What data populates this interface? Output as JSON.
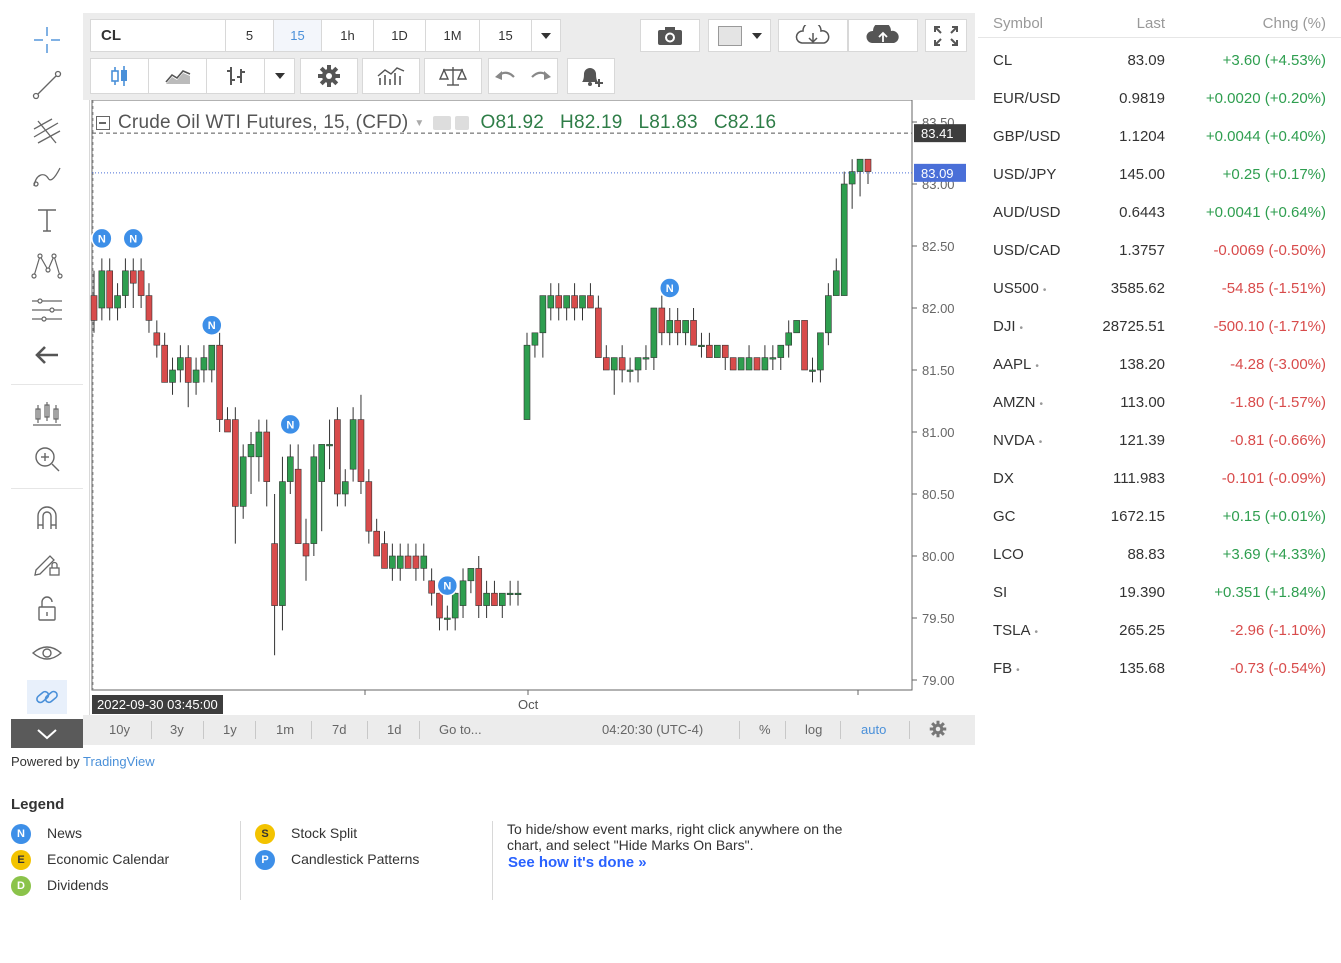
{
  "toolbar": {
    "symbol": "CL",
    "intervals": [
      "5",
      "15",
      "1h",
      "1D",
      "1M",
      "15"
    ],
    "active_interval_index": 1
  },
  "chart": {
    "title": "Crude Oil WTI Futures, 15, (CFD)",
    "ohlc": {
      "o": "O81.92",
      "h": "H82.19",
      "l": "L81.83",
      "c": "C82.16"
    },
    "price_axis": [
      "83.50",
      "83.00",
      "82.50",
      "82.00",
      "81.50",
      "81.00",
      "80.50",
      "80.00",
      "79.50",
      "79.00"
    ],
    "last_price_label": "83.09",
    "high_label": "83.41",
    "x_label_oct": "Oct",
    "crosshair_time": "2022-09-30 03:45:00",
    "news_marker": "N",
    "bottom": {
      "ranges": [
        "10y",
        "3y",
        "1y",
        "1m",
        "7d",
        "1d"
      ],
      "goto": "Go to...",
      "clock": "04:20:30 (UTC-4)",
      "percent": "%",
      "log": "log",
      "auto": "auto"
    },
    "colors": {
      "up": "#2e9e4f",
      "down": "#d84b4b",
      "last": "#4a6fd8"
    }
  },
  "watchlist": {
    "headers": {
      "symbol": "Symbol",
      "last": "Last",
      "change": "Chng (%)"
    },
    "rows": [
      {
        "symbol": "CL",
        "last": "83.09",
        "change": "+3.60 (+4.53%)",
        "up": true,
        "dot": false
      },
      {
        "symbol": "EUR/USD",
        "last": "0.9819",
        "change": "+0.0020 (+0.20%)",
        "up": true,
        "dot": false
      },
      {
        "symbol": "GBP/USD",
        "last": "1.1204",
        "change": "+0.0044 (+0.40%)",
        "up": true,
        "dot": false
      },
      {
        "symbol": "USD/JPY",
        "last": "145.00",
        "change": "+0.25 (+0.17%)",
        "up": true,
        "dot": false
      },
      {
        "symbol": "AUD/USD",
        "last": "0.6443",
        "change": "+0.0041 (+0.64%)",
        "up": true,
        "dot": false
      },
      {
        "symbol": "USD/CAD",
        "last": "1.3757",
        "change": "-0.0069 (-0.50%)",
        "up": false,
        "dot": false
      },
      {
        "symbol": "US500",
        "last": "3585.62",
        "change": "-54.85 (-1.51%)",
        "up": false,
        "dot": true
      },
      {
        "symbol": "DJI",
        "last": "28725.51",
        "change": "-500.10 (-1.71%)",
        "up": false,
        "dot": true
      },
      {
        "symbol": "AAPL",
        "last": "138.20",
        "change": "-4.28 (-3.00%)",
        "up": false,
        "dot": true
      },
      {
        "symbol": "AMZN",
        "last": "113.00",
        "change": "-1.80 (-1.57%)",
        "up": false,
        "dot": true
      },
      {
        "symbol": "NVDA",
        "last": "121.39",
        "change": "-0.81 (-0.66%)",
        "up": false,
        "dot": true
      },
      {
        "symbol": "DX",
        "last": "111.983",
        "change": "-0.101 (-0.09%)",
        "up": false,
        "dot": false
      },
      {
        "symbol": "GC",
        "last": "1672.15",
        "change": "+0.15 (+0.01%)",
        "up": true,
        "dot": false
      },
      {
        "symbol": "LCO",
        "last": "88.83",
        "change": "+3.69 (+4.33%)",
        "up": true,
        "dot": false
      },
      {
        "symbol": "SI",
        "last": "19.390",
        "change": "+0.351 (+1.84%)",
        "up": true,
        "dot": false
      },
      {
        "symbol": "TSLA",
        "last": "265.25",
        "change": "-2.96 (-1.10%)",
        "up": false,
        "dot": true
      },
      {
        "symbol": "FB",
        "last": "135.68",
        "change": "-0.73 (-0.54%)",
        "up": false,
        "dot": true
      }
    ],
    "up_color": "#2e9e4f",
    "down_color": "#d84b4b"
  },
  "powered_by": {
    "prefix": "Powered by",
    "brand": "TradingView"
  },
  "legend": {
    "title": "Legend",
    "items": [
      {
        "letter": "N",
        "label": "News",
        "color": "#3d8fe8"
      },
      {
        "letter": "E",
        "label": "Economic Calendar",
        "color": "#f3c300"
      },
      {
        "letter": "D",
        "label": "Dividends",
        "color": "#8bc34a"
      },
      {
        "letter": "S",
        "label": "Stock Split",
        "color": "#f3c300"
      },
      {
        "letter": "P",
        "label": "Candlestick Patterns",
        "color": "#3d8fe8"
      }
    ],
    "hint": "To hide/show event marks, right click anywhere on the chart, and select \"Hide Marks On Bars\".",
    "link": "See how it's done »"
  },
  "chart_data": {
    "type": "candlestick",
    "title": "Crude Oil WTI Futures, 15, (CFD)",
    "ylim": [
      79.0,
      83.5
    ],
    "x_tick_labels": [
      "Oct"
    ],
    "candles": [
      [
        82.1,
        82.3,
        81.8,
        81.9
      ],
      [
        82.0,
        82.4,
        81.9,
        82.3
      ],
      [
        82.3,
        82.4,
        81.9,
        82.0
      ],
      [
        82.0,
        82.2,
        81.9,
        82.1
      ],
      [
        82.1,
        82.4,
        82.0,
        82.3
      ],
      [
        82.3,
        82.4,
        82.0,
        82.2
      ],
      [
        82.3,
        82.4,
        82.0,
        82.1
      ],
      [
        82.1,
        82.2,
        81.8,
        81.9
      ],
      [
        81.8,
        81.9,
        81.6,
        81.7
      ],
      [
        81.7,
        81.8,
        81.4,
        81.4
      ],
      [
        81.4,
        81.6,
        81.3,
        81.5
      ],
      [
        81.5,
        81.7,
        81.4,
        81.6
      ],
      [
        81.6,
        81.7,
        81.2,
        81.4
      ],
      [
        81.4,
        81.6,
        81.3,
        81.5
      ],
      [
        81.5,
        81.7,
        81.4,
        81.6
      ],
      [
        81.5,
        81.7,
        81.4,
        81.7
      ],
      [
        81.7,
        81.8,
        81.0,
        81.1
      ],
      [
        81.1,
        81.2,
        81.0,
        81.0
      ],
      [
        81.1,
        81.2,
        80.1,
        80.4
      ],
      [
        80.4,
        80.9,
        80.3,
        80.8
      ],
      [
        80.8,
        81.0,
        80.5,
        80.9
      ],
      [
        80.8,
        81.1,
        80.6,
        81.0
      ],
      [
        81.0,
        81.1,
        80.4,
        80.6
      ],
      [
        80.1,
        80.5,
        79.2,
        79.6
      ],
      [
        79.6,
        80.8,
        79.4,
        80.6
      ],
      [
        80.6,
        80.9,
        80.5,
        80.8
      ],
      [
        80.7,
        80.9,
        80.1,
        80.1
      ],
      [
        80.1,
        80.3,
        79.8,
        80.0
      ],
      [
        80.1,
        80.9,
        80.0,
        80.8
      ],
      [
        80.6,
        80.9,
        80.2,
        80.9
      ],
      [
        80.9,
        81.1,
        80.7,
        80.9
      ],
      [
        81.1,
        81.2,
        80.4,
        80.5
      ],
      [
        80.5,
        80.7,
        80.4,
        80.6
      ],
      [
        80.7,
        81.2,
        80.6,
        81.1
      ],
      [
        81.1,
        81.3,
        80.5,
        80.6
      ],
      [
        80.6,
        80.7,
        80.1,
        80.2
      ],
      [
        80.2,
        80.3,
        80.1,
        80.0
      ],
      [
        80.1,
        80.2,
        79.9,
        79.9
      ],
      [
        79.9,
        80.1,
        79.8,
        80.0
      ],
      [
        79.9,
        80.1,
        79.8,
        80.0
      ],
      [
        80.0,
        80.1,
        79.9,
        79.9
      ],
      [
        80.0,
        80.1,
        79.8,
        79.9
      ],
      [
        79.9,
        80.1,
        79.8,
        80.0
      ],
      [
        79.8,
        79.9,
        79.6,
        79.7
      ],
      [
        79.7,
        79.8,
        79.4,
        79.5
      ],
      [
        79.5,
        79.6,
        79.4,
        79.5
      ],
      [
        79.5,
        79.8,
        79.4,
        79.7
      ],
      [
        79.6,
        79.9,
        79.5,
        79.8
      ],
      [
        79.8,
        79.9,
        79.7,
        79.9
      ],
      [
        79.9,
        80.0,
        79.5,
        79.6
      ],
      [
        79.6,
        79.8,
        79.5,
        79.7
      ],
      [
        79.7,
        79.8,
        79.6,
        79.6
      ],
      [
        79.6,
        79.7,
        79.5,
        79.7
      ],
      [
        79.7,
        79.8,
        79.6,
        79.7
      ],
      [
        79.7,
        79.8,
        79.6,
        79.7
      ],
      [
        81.1,
        81.8,
        81.1,
        81.7
      ],
      [
        81.7,
        81.8,
        81.6,
        81.8
      ],
      [
        81.8,
        82.1,
        81.6,
        82.1
      ],
      [
        82.0,
        82.2,
        81.9,
        82.1
      ],
      [
        82.1,
        82.2,
        81.9,
        82.0
      ],
      [
        82.0,
        82.1,
        81.9,
        82.1
      ],
      [
        82.1,
        82.2,
        81.9,
        82.0
      ],
      [
        82.0,
        82.1,
        81.9,
        82.1
      ],
      [
        82.1,
        82.2,
        82.0,
        82.0
      ],
      [
        82.0,
        82.1,
        81.6,
        81.6
      ],
      [
        81.6,
        81.7,
        81.5,
        81.5
      ],
      [
        81.5,
        81.6,
        81.3,
        81.6
      ],
      [
        81.6,
        81.7,
        81.4,
        81.5
      ],
      [
        81.5,
        81.6,
        81.4,
        81.5
      ],
      [
        81.5,
        81.6,
        81.4,
        81.6
      ],
      [
        81.6,
        81.7,
        81.5,
        81.6
      ],
      [
        81.6,
        82.0,
        81.5,
        82.0
      ],
      [
        82.0,
        82.1,
        81.7,
        81.8
      ],
      [
        81.8,
        82.0,
        81.7,
        81.9
      ],
      [
        81.9,
        82.0,
        81.7,
        81.8
      ],
      [
        81.8,
        81.9,
        81.7,
        81.9
      ],
      [
        81.9,
        82.0,
        81.7,
        81.7
      ],
      [
        81.7,
        81.8,
        81.6,
        81.7
      ],
      [
        81.7,
        81.8,
        81.6,
        81.6
      ],
      [
        81.6,
        81.7,
        81.6,
        81.7
      ],
      [
        81.7,
        81.7,
        81.5,
        81.6
      ],
      [
        81.6,
        81.6,
        81.5,
        81.5
      ],
      [
        81.5,
        81.6,
        81.5,
        81.6
      ],
      [
        81.5,
        81.7,
        81.5,
        81.6
      ],
      [
        81.6,
        81.6,
        81.5,
        81.5
      ],
      [
        81.5,
        81.7,
        81.5,
        81.6
      ],
      [
        81.6,
        81.7,
        81.5,
        81.6
      ],
      [
        81.6,
        81.7,
        81.5,
        81.7
      ],
      [
        81.7,
        81.9,
        81.6,
        81.8
      ],
      [
        81.8,
        81.9,
        81.8,
        81.9
      ],
      [
        81.9,
        81.9,
        81.5,
        81.5
      ],
      [
        81.5,
        81.6,
        81.4,
        81.5
      ],
      [
        81.5,
        81.8,
        81.4,
        81.8
      ],
      [
        81.8,
        82.2,
        81.7,
        82.1
      ],
      [
        82.1,
        82.4,
        82.1,
        82.3
      ],
      [
        82.1,
        83.1,
        82.1,
        83.0
      ],
      [
        83.0,
        83.2,
        82.8,
        83.1
      ],
      [
        83.1,
        83.2,
        82.9,
        83.2
      ],
      [
        83.2,
        83.2,
        83.0,
        83.1
      ]
    ],
    "news_marks": [
      1,
      5,
      15,
      25,
      45,
      73
    ]
  }
}
